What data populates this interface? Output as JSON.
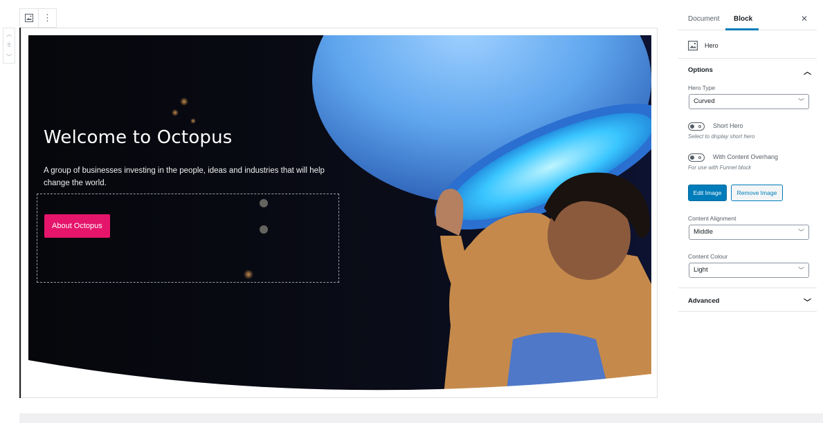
{
  "toolbar": {
    "block_type_icon": "image-icon",
    "more_options_icon": "more-vertical-icon"
  },
  "mover": {
    "up_icon": "chevron-up-icon",
    "drag_icon": "drag-handle-icon",
    "down_icon": "chevron-down-icon"
  },
  "hero": {
    "title": "Welcome to Octopus",
    "description": "A group of businesses investing in the people, ideas and industries that will help change the world.",
    "button_label": "About Octopus"
  },
  "sidebar": {
    "tabs": [
      {
        "label": "Document",
        "active": false
      },
      {
        "label": "Block",
        "active": true
      }
    ],
    "close_icon": "close-icon",
    "block": {
      "icon": "image-icon",
      "name": "Hero"
    },
    "options_panel": {
      "title": "Options",
      "chevron_icon": "chevron-up-icon",
      "hero_type": {
        "label": "Hero Type",
        "value": "Curved"
      },
      "short_hero": {
        "label": "Short Hero",
        "help": "Select to display short hero",
        "checked": false
      },
      "content_overhang": {
        "label": "With Content Overhang",
        "help": "For use with Funnel block",
        "checked": false
      },
      "edit_image_label": "Edit Image",
      "remove_image_label": "Remove Image",
      "content_alignment": {
        "label": "Content Alignment",
        "value": "Middle"
      },
      "content_colour": {
        "label": "Content Colour",
        "value": "Light"
      }
    },
    "advanced_panel": {
      "title": "Advanced",
      "chevron_icon": "chevron-down-icon"
    }
  },
  "colors": {
    "accent": "#007cba",
    "cta": "#e5156b",
    "hero_background": "#07080c"
  }
}
